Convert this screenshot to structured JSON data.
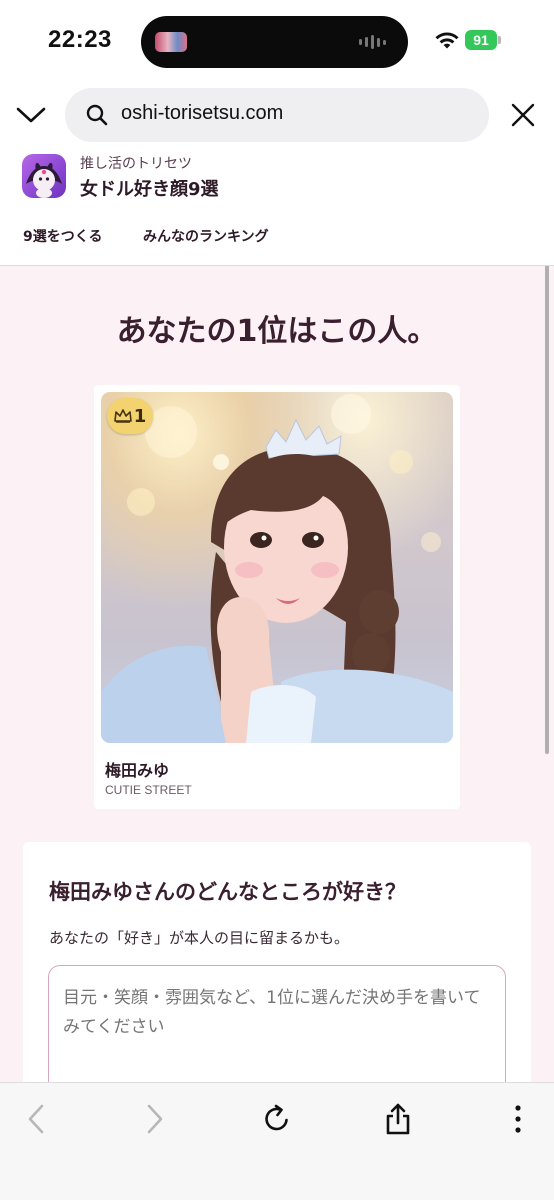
{
  "status_bar": {
    "time": "22:23",
    "battery_level": "91",
    "icons": [
      "music-thumbnail-icon",
      "audio-wave-icon",
      "wifi-icon",
      "battery-icon"
    ]
  },
  "browser": {
    "url": "oshi-torisetsu.com",
    "icons": [
      "chevron-down-icon",
      "search-icon",
      "close-icon"
    ]
  },
  "site": {
    "subtitle": "推し活のトリセツ",
    "title": "女ドル好き顔9選",
    "nav": [
      {
        "label": "9選をつくる"
      },
      {
        "label": "みんなのランキング"
      }
    ]
  },
  "result": {
    "headline": "あなたの1位はこの人。",
    "rank": "1",
    "name": "梅田みゆ",
    "group": "CUTIE STREET"
  },
  "question": {
    "title": "梅田みゆさんのどんなところが好き？",
    "subtitle": "あなたの「好き」が本人の目に留まるかも。",
    "placeholder": "目元・笑顔・雰囲気など、1位に選んだ決め手を書いてみてください"
  },
  "toolbar": {
    "icons": [
      "back-arrow-icon",
      "forward-arrow-icon",
      "reload-icon",
      "share-icon",
      "more-icon"
    ]
  },
  "colors": {
    "content_bg": "#fcf1f5",
    "heading": "#3a1f2e",
    "badge": "#f3d36f",
    "battery": "#34c759",
    "input_border": "#d8a6c0"
  }
}
